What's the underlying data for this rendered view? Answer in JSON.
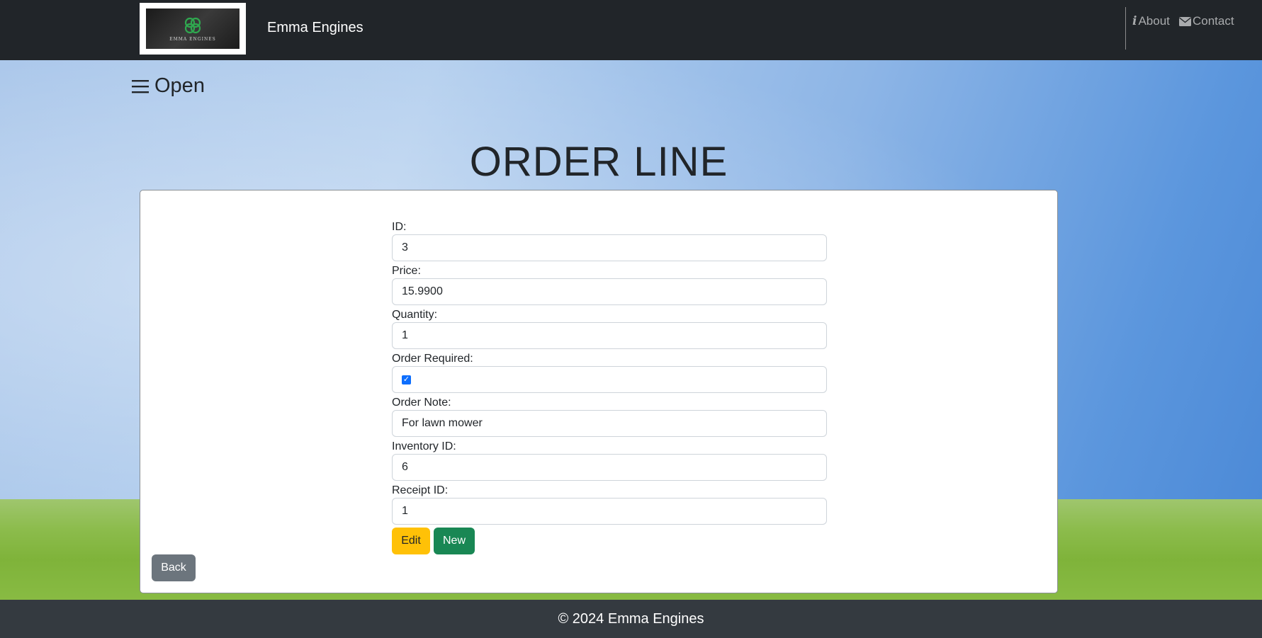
{
  "navbar": {
    "brand": "Emma Engines",
    "logo_text": "EMMA ENGINES",
    "links": [
      {
        "label": "About",
        "icon": "info-icon"
      },
      {
        "label": "Contact",
        "icon": "envelope-icon"
      }
    ]
  },
  "sidebar_toggle": {
    "icon": "hamburger-icon",
    "label": "Open"
  },
  "page_title": "ORDER LINE",
  "form": {
    "fields": [
      {
        "label": "ID:",
        "value": "3"
      },
      {
        "label": "Price:",
        "value": "15.9900"
      },
      {
        "label": "Quantity:",
        "value": "1"
      },
      {
        "label": "Order Required:",
        "value": "checked"
      },
      {
        "label": "Order Note:",
        "value": "For lawn mower"
      },
      {
        "label": "Inventory ID:",
        "value": "6"
      },
      {
        "label": "Receipt ID:",
        "value": "1"
      }
    ],
    "edit_label": "Edit",
    "new_label": "New",
    "back_label": "Back"
  },
  "colors": {
    "navbar": "#212529",
    "edit": "#ffc107",
    "new": "#198754",
    "back": "#6c757d",
    "footer": "#343a40"
  },
  "footer": {
    "text": "© 2024 Emma Engines"
  }
}
